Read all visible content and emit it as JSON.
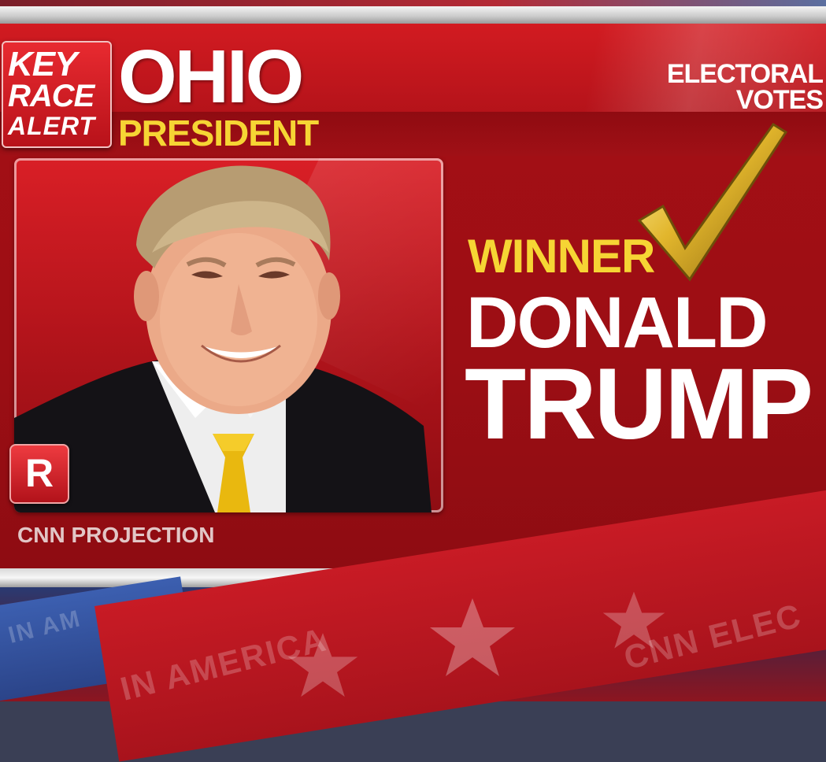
{
  "alert_badge": {
    "line1": "KEY",
    "line2": "RACE",
    "line3": "ALERT"
  },
  "race": {
    "state": "OHIO",
    "office": "PRESIDENT"
  },
  "electoral": {
    "line1": "ELECTORAL",
    "line2": "VOTES"
  },
  "result": {
    "label": "WINNER",
    "first_name": "DONALD",
    "last_name": "TRUMP"
  },
  "party_badge": "R",
  "source_label": "CNN PROJECTION",
  "background_text": {
    "left": "IN AMERICA",
    "right": "CNN ELEC",
    "far_left": "IN AM"
  },
  "colors": {
    "panel_red": "#a30f15",
    "accent_yellow": "#f6d534",
    "text_white": "#ffffff"
  },
  "icons": {
    "check": "gold-checkmark-icon",
    "portrait": "candidate-portrait"
  }
}
